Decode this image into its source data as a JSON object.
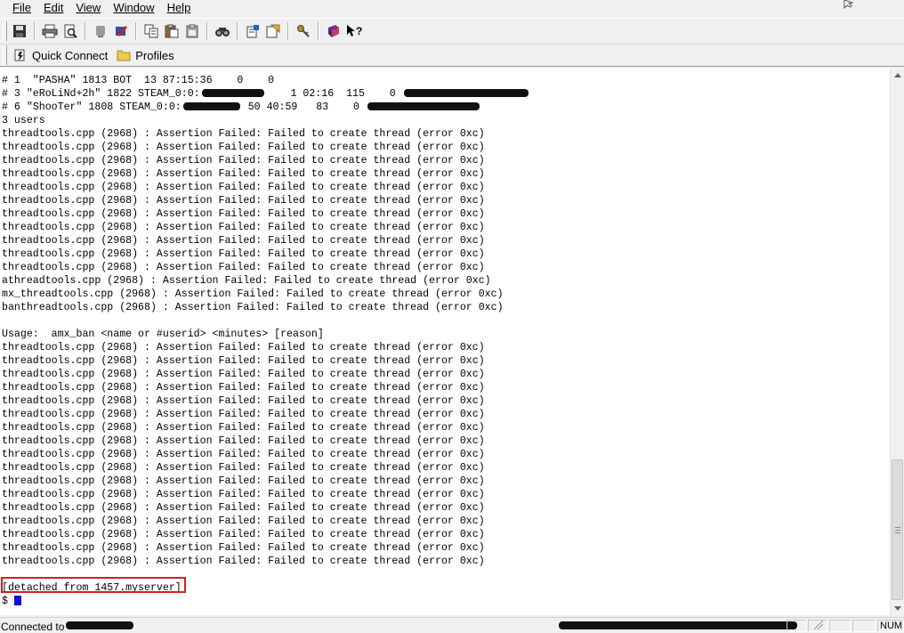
{
  "menu": {
    "file": "File",
    "edit": "Edit",
    "view": "View",
    "window": "Window",
    "help": "Help"
  },
  "toolbar_icons": [
    "save-icon",
    "print-icon",
    "print-preview-icon",
    "disconnect-icon",
    "settings-icon",
    "copy-icon",
    "paste-icon",
    "paste-alt-icon",
    "find-icon",
    "file-transfer-icon",
    "tunnel-icon",
    "key-generator-icon",
    "help-book-icon",
    "context-help-icon"
  ],
  "quickbar": {
    "quick_connect": "Quick Connect",
    "profiles": "Profiles"
  },
  "terminal": {
    "lines": [
      {
        "text": "# 1  \"PASHA\" 1813 BOT  13 87:15:36    0    0"
      },
      {
        "text": "# 3 \"eRoLiNd+2h\" 1822 STEAM_0:0:",
        "redact": 70,
        "after": "    1 02:16  115    0 ",
        "redact2": 140
      },
      {
        "text": "# 6 \"ShooTer\" 1808 STEAM_0:0:",
        "redact": 64,
        "after": " 50 40:59   83    0 ",
        "redact2": 126
      },
      {
        "text": "3 users"
      },
      {
        "text": "threadtools.cpp (2968) : Assertion Failed: Failed to create thread (error 0xc)"
      },
      {
        "text": "threadtools.cpp (2968) : Assertion Failed: Failed to create thread (error 0xc)"
      },
      {
        "text": "threadtools.cpp (2968) : Assertion Failed: Failed to create thread (error 0xc)"
      },
      {
        "text": "threadtools.cpp (2968) : Assertion Failed: Failed to create thread (error 0xc)"
      },
      {
        "text": "threadtools.cpp (2968) : Assertion Failed: Failed to create thread (error 0xc)"
      },
      {
        "text": "threadtools.cpp (2968) : Assertion Failed: Failed to create thread (error 0xc)"
      },
      {
        "text": "threadtools.cpp (2968) : Assertion Failed: Failed to create thread (error 0xc)"
      },
      {
        "text": "threadtools.cpp (2968) : Assertion Failed: Failed to create thread (error 0xc)"
      },
      {
        "text": "threadtools.cpp (2968) : Assertion Failed: Failed to create thread (error 0xc)"
      },
      {
        "text": "threadtools.cpp (2968) : Assertion Failed: Failed to create thread (error 0xc)"
      },
      {
        "text": "threadtools.cpp (2968) : Assertion Failed: Failed to create thread (error 0xc)"
      },
      {
        "text": "athreadtools.cpp (2968) : Assertion Failed: Failed to create thread (error 0xc)"
      },
      {
        "text": "mx_threadtools.cpp (2968) : Assertion Failed: Failed to create thread (error 0xc)"
      },
      {
        "text": "banthreadtools.cpp (2968) : Assertion Failed: Failed to create thread (error 0xc)"
      },
      {
        "text": ""
      },
      {
        "text": "Usage:  amx_ban <name or #userid> <minutes> [reason]"
      },
      {
        "text": "threadtools.cpp (2968) : Assertion Failed: Failed to create thread (error 0xc)"
      },
      {
        "text": "threadtools.cpp (2968) : Assertion Failed: Failed to create thread (error 0xc)"
      },
      {
        "text": "threadtools.cpp (2968) : Assertion Failed: Failed to create thread (error 0xc)"
      },
      {
        "text": "threadtools.cpp (2968) : Assertion Failed: Failed to create thread (error 0xc)"
      },
      {
        "text": "threadtools.cpp (2968) : Assertion Failed: Failed to create thread (error 0xc)"
      },
      {
        "text": "threadtools.cpp (2968) : Assertion Failed: Failed to create thread (error 0xc)"
      },
      {
        "text": "threadtools.cpp (2968) : Assertion Failed: Failed to create thread (error 0xc)"
      },
      {
        "text": "threadtools.cpp (2968) : Assertion Failed: Failed to create thread (error 0xc)"
      },
      {
        "text": "threadtools.cpp (2968) : Assertion Failed: Failed to create thread (error 0xc)"
      },
      {
        "text": "threadtools.cpp (2968) : Assertion Failed: Failed to create thread (error 0xc)"
      },
      {
        "text": "threadtools.cpp (2968) : Assertion Failed: Failed to create thread (error 0xc)"
      },
      {
        "text": "threadtools.cpp (2968) : Assertion Failed: Failed to create thread (error 0xc)"
      },
      {
        "text": "threadtools.cpp (2968) : Assertion Failed: Failed to create thread (error 0xc)"
      },
      {
        "text": "threadtools.cpp (2968) : Assertion Failed: Failed to create thread (error 0xc)"
      },
      {
        "text": "threadtools.cpp (2968) : Assertion Failed: Failed to create thread (error 0xc)"
      },
      {
        "text": "threadtools.cpp (2968) : Assertion Failed: Failed to create thread (error 0xc)"
      },
      {
        "text": "threadtools.cpp (2968) : Assertion Failed: Failed to create thread (error 0xc)"
      },
      {
        "text": ""
      },
      {
        "text": "[detached from 1457.myserver]"
      },
      {
        "text": "$ ",
        "cursor": true
      }
    ]
  },
  "status": {
    "connected": "Connected to",
    "num": "NUM"
  }
}
